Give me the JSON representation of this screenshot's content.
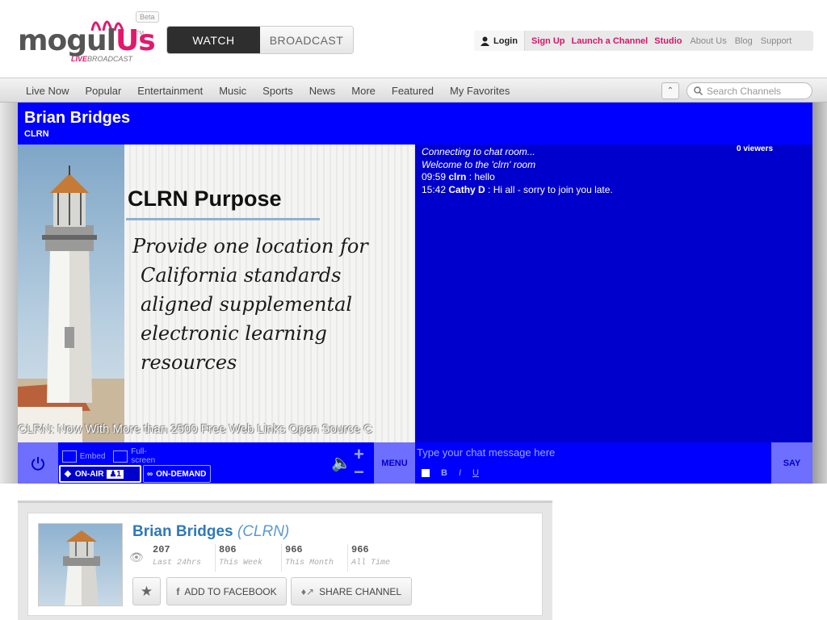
{
  "brand": {
    "logo_main": "mogul",
    "logo_accent": "Us",
    "beta": "Beta",
    "tm": "TM",
    "tagline_live": "LIVE",
    "tagline_rest": "BROADCAST",
    "accent_color": "#e0196e"
  },
  "mode_toggle": {
    "watch": "WATCH",
    "broadcast": "BROADCAST"
  },
  "top_links": {
    "login": "Login",
    "signup": "Sign Up",
    "launch": "Launch a Channel",
    "studio": "Studio",
    "about": "About Us",
    "blog": "Blog",
    "support": "Support"
  },
  "nav": {
    "items": [
      "Live Now",
      "Popular",
      "Entertainment",
      "Music",
      "Sports",
      "News",
      "More",
      "Featured",
      "My Favorites"
    ],
    "search_placeholder": "Search Channels"
  },
  "channel": {
    "title": "Brian Bridges",
    "subtitle": "CLRN",
    "panel_color": "#0000ff"
  },
  "slide": {
    "title": "CLRN Purpose",
    "lines": [
      "Provide one location for",
      "California standards",
      "aligned supplemental",
      "electronic learning",
      "resources"
    ],
    "ticker": "CLRN: Now With More than 2500 Free Web Links     Open Source C"
  },
  "chat": {
    "viewers": "0 viewers",
    "system_lines": [
      "Connecting to chat room...",
      "Welcome to the 'clrn' room"
    ],
    "messages": [
      {
        "time": "09:59",
        "user": "clrn",
        "text": " : hello"
      },
      {
        "time": "15:42",
        "user": "Cathy D",
        "text": " : Hi all - sorry to join you late."
      }
    ],
    "input_placeholder": "Type your chat message here",
    "bold": "B",
    "italic": "I",
    "underline": "U",
    "say": "SAY"
  },
  "controls": {
    "embed": "Embed",
    "fullscreen": "Full-screen",
    "on_air": "ON-AIR",
    "viewer_count": "1",
    "on_demand": "ON-DEMAND",
    "menu": "MENU"
  },
  "card": {
    "name": "Brian Bridges",
    "sub": "(CLRN)",
    "stats": [
      {
        "value": "207",
        "label": "Last 24hrs"
      },
      {
        "value": "806",
        "label": "This Week"
      },
      {
        "value": "966",
        "label": "This Month"
      },
      {
        "value": "966",
        "label": "All Time"
      }
    ],
    "facebook": "ADD TO FACEBOOK",
    "share": "SHARE CHANNEL"
  }
}
